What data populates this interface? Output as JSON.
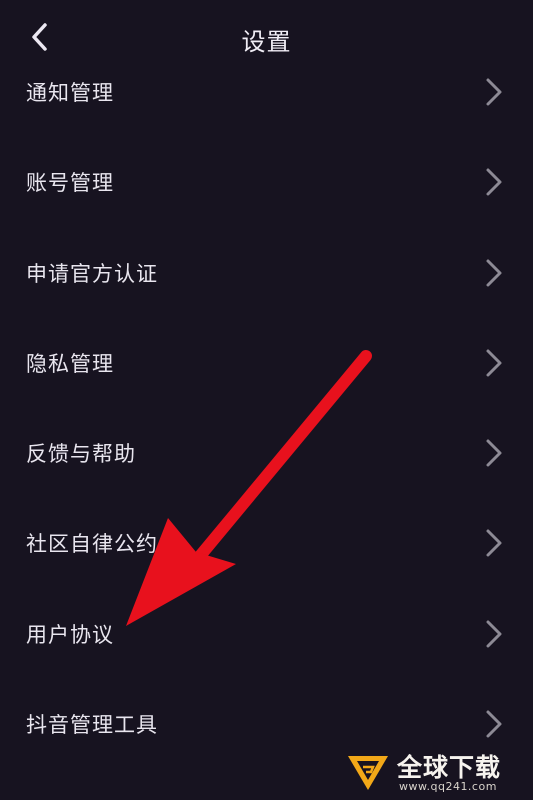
{
  "header": {
    "title": "设置",
    "back_icon": "chevron-left-icon"
  },
  "settings": {
    "items": [
      {
        "label": "通知管理"
      },
      {
        "label": "账号管理"
      },
      {
        "label": "申请官方认证"
      },
      {
        "label": "隐私管理"
      },
      {
        "label": "反馈与帮助"
      },
      {
        "label": "社区自律公约"
      },
      {
        "label": "用户协议"
      },
      {
        "label": "抖音管理工具"
      }
    ],
    "chevron_icon": "chevron-right-icon"
  },
  "annotation": {
    "arrow_color": "#e8111d",
    "points_to": "用户协议"
  },
  "watermark": {
    "brand": "全球下载",
    "url": "www.qq241.com",
    "accent_color": "#f2a818"
  },
  "colors": {
    "background": "#171320",
    "text": "#e9e6ef",
    "chevron": "#8d8a95"
  }
}
